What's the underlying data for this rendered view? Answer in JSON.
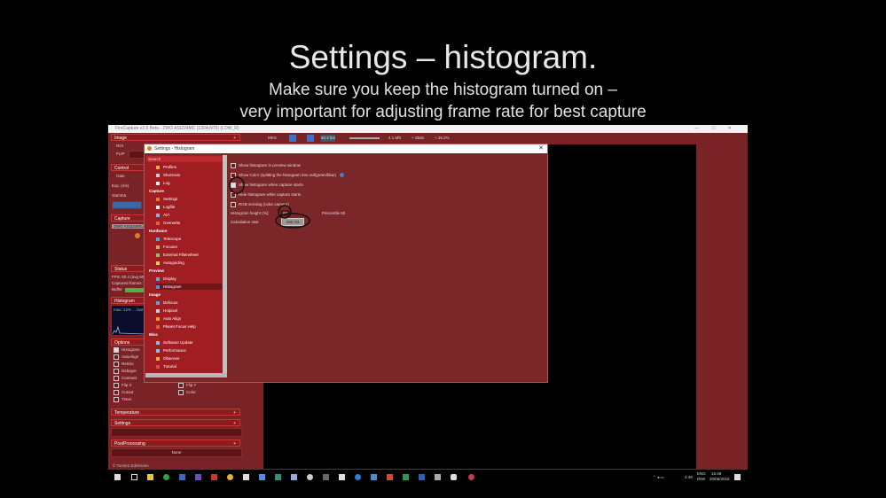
{
  "slide": {
    "title": "Settings – histogram.",
    "subtitle_line1": "Make sure you keep the histogram turned on –",
    "subtitle_line2": "very important for adjusting frame rate for best capture"
  },
  "window": {
    "title": "FireCapture v2.6  Beta  -  ZWO ASI224MC (1304x976) (LOW_R)",
    "controls": [
      "—",
      "☐",
      "✕"
    ]
  },
  "toolbar": {
    "items": [
      "MKS",
      "60.4 fps"
    ],
    "levels": [
      "4.1 MS",
      "+ Stats",
      "+ 16.2%"
    ]
  },
  "left_panel": {
    "image": {
      "header": "Image",
      "rows": [
        "ROI",
        "FLIP"
      ]
    },
    "control": {
      "header": "Control",
      "rows": [
        "Gain",
        "Exp. (ms)",
        "Gamma"
      ]
    },
    "capture": {
      "header": "Capture",
      "file": "ZWO ASI224MC/..."
    },
    "status": {
      "header": "Status",
      "rows": [
        "FPS: 60.4 (avg 60.0)",
        "Captured frames: 0",
        "Buffer"
      ]
    },
    "histogram": {
      "header": "Histogram",
      "text": "max: 12%  ... last"
    },
    "options": {
      "header": "Options",
      "items": [
        "Histogram",
        "AutoAlign",
        "Reticle",
        "Debayer",
        "Contrast",
        "Flip X",
        "Cutout",
        "Timer",
        "Flip Y",
        "Color"
      ]
    },
    "temperature": {
      "header": "Temperature"
    },
    "settings": {
      "header": "Settings"
    },
    "postprocessing": {
      "header": "PostProcessing",
      "row": "None"
    },
    "footer": "© Torsten Edelmann"
  },
  "dialog": {
    "title": "Settings - Histogram",
    "close": "✕",
    "search_label": "Search",
    "tree": [
      {
        "kind": "item",
        "label": "Profiles",
        "color": "#e3b341"
      },
      {
        "kind": "item",
        "label": "Shortcuts",
        "color": "#cccccc"
      },
      {
        "kind": "item",
        "label": "Log",
        "color": "#e8e8e8"
      },
      {
        "kind": "cat",
        "label": "Capture"
      },
      {
        "kind": "item",
        "label": "Settings",
        "color": "#e87c2a"
      },
      {
        "kind": "item",
        "label": "Logfile",
        "color": "#eeeeee"
      },
      {
        "kind": "item",
        "label": "AVI",
        "color": "#7db1e8"
      },
      {
        "kind": "item",
        "label": "Overwrite",
        "color": "#e8594a"
      },
      {
        "kind": "cat",
        "label": "Hardware"
      },
      {
        "kind": "item",
        "label": "Telescope",
        "color": "#59a0e0"
      },
      {
        "kind": "item",
        "label": "Focuser",
        "color": "#d1a85e"
      },
      {
        "kind": "item",
        "label": "External Filterwheel",
        "color": "#86c46a"
      },
      {
        "kind": "item",
        "label": "Autoguiding",
        "color": "#e8d44a"
      },
      {
        "kind": "cat",
        "label": "Preview"
      },
      {
        "kind": "item",
        "label": "Display",
        "color": "#6aa3e0"
      },
      {
        "kind": "item",
        "label": "Histogram",
        "color": "#4f8de0",
        "selected": true
      },
      {
        "kind": "cat",
        "label": "Image"
      },
      {
        "kind": "item",
        "label": "Defocus",
        "color": "#5ea0d8"
      },
      {
        "kind": "item",
        "label": "Hotpixel",
        "color": "#cccccc"
      },
      {
        "kind": "item",
        "label": "Auto Align",
        "color": "#e59b3a"
      },
      {
        "kind": "item",
        "label": "Planet Focus Help",
        "color": "#e85a3a"
      },
      {
        "kind": "cat",
        "label": "Misc"
      },
      {
        "kind": "item",
        "label": "Software Update",
        "color": "#8fb5e6"
      },
      {
        "kind": "item",
        "label": "Performance",
        "color": "#7fc6e0"
      },
      {
        "kind": "item",
        "label": "Observer",
        "color": "#e8b03a"
      },
      {
        "kind": "item",
        "label": "Tutorial",
        "color": "#e04a4a"
      }
    ],
    "options": [
      {
        "label": "Show histogram in preview window",
        "checked": false
      },
      {
        "label": "Show Color (splitting the histogram into red/green/blue)",
        "checked": false,
        "hint": true
      },
      {
        "label": "Show histogram when capture starts",
        "checked": true
      },
      {
        "label": "Hide histogram while capture starts",
        "checked": false
      },
      {
        "label": "RGB sensing (color camera)",
        "checked": false
      }
    ],
    "histogram_height_label": "Histogram height (%):",
    "histogram_height_value": "60",
    "histogram_height_extra": "Percentile 50",
    "calculation_rate_label": "Calculation rate:",
    "calculation_rate_value": "100 ms"
  },
  "taskbar": {
    "tray_lang": "ENG",
    "tray_region": "DNK",
    "time": "15:49",
    "date": "20/05/2018",
    "clock": "4:49"
  }
}
